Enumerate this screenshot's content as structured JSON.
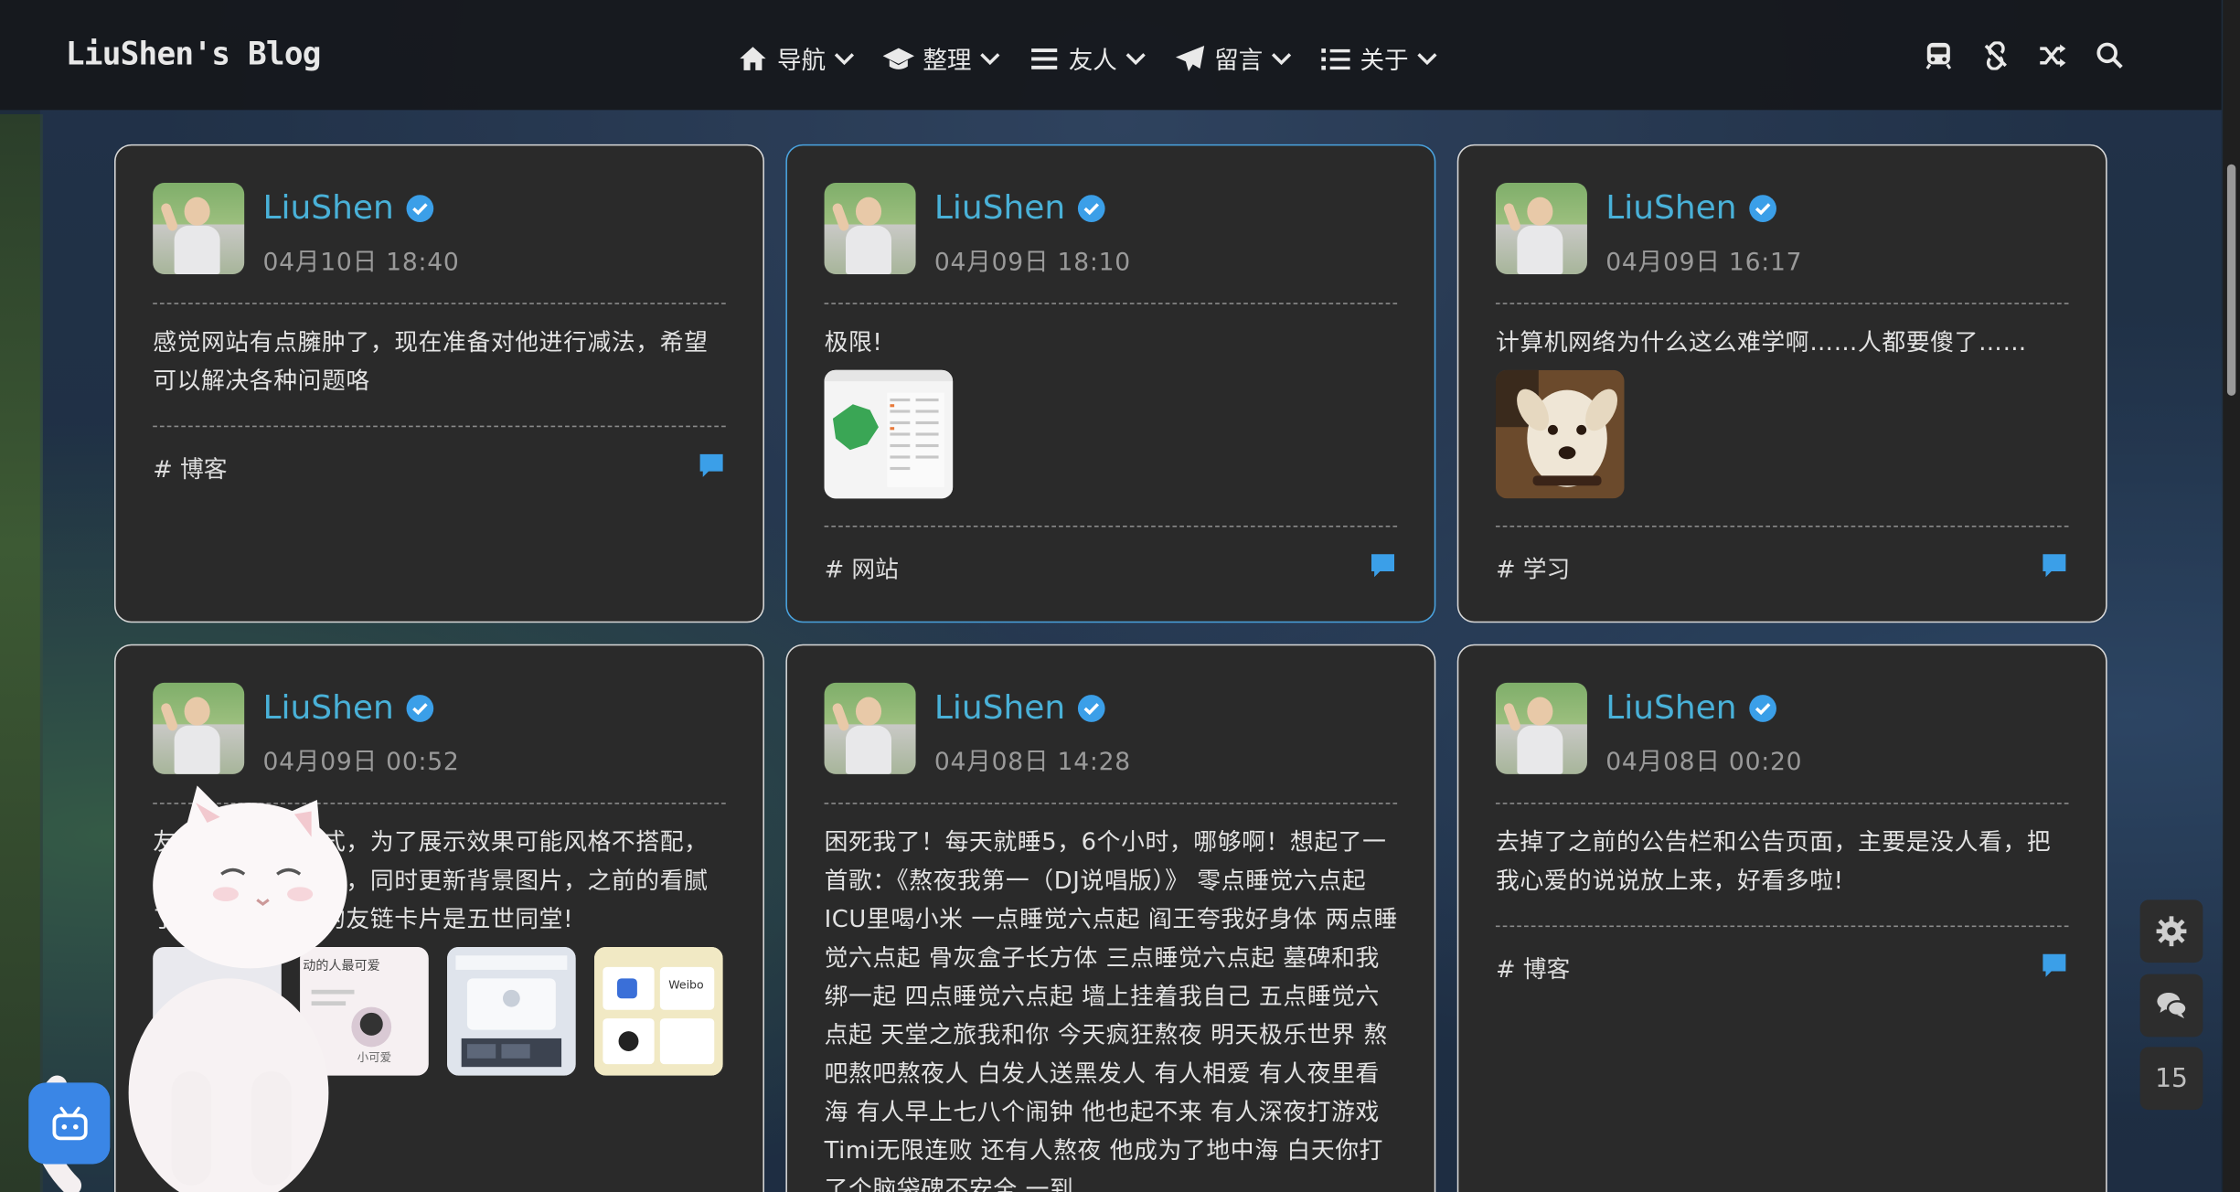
{
  "brand": "LiuShen's Blog",
  "nav": {
    "items": [
      {
        "icon": "home-icon",
        "label": "导航"
      },
      {
        "icon": "graduation-cap-icon",
        "label": "整理"
      },
      {
        "icon": "bars-icon",
        "label": "友人"
      },
      {
        "icon": "paper-plane-icon",
        "label": "留言"
      },
      {
        "icon": "list-icon",
        "label": "关于"
      }
    ],
    "right_icons": [
      "subway-icon",
      "unlink-icon",
      "shuffle-icon",
      "search-icon"
    ]
  },
  "cards": [
    {
      "user": "LiuShen",
      "date": "04月10日 18:40",
      "text": "感觉网站有点臃肿了，现在准备对他进行减法，希望可以解决各种问题咯",
      "tag": "# 博客"
    },
    {
      "user": "LiuShen",
      "date": "04月09日 18:10",
      "text": "极限!",
      "tag": "# 网站"
    },
    {
      "user": "LiuShen",
      "date": "04月09日 16:17",
      "text": "计算机网络为什么这么难学啊……人都要傻了……",
      "tag": "# 学习"
    },
    {
      "user": "LiuShen",
      "date": "04月09日 00:52",
      "text": "友链卡片换了样式，为了展示效果可能风格不搭配，这是重新写出来的，同时更新背景图片，之前的看腻了，哈哈，现在的友链卡片是五世同堂!",
      "thumb_texts": [
        "动的人最可爱",
        "小可爱",
        "Weibo"
      ]
    },
    {
      "user": "LiuShen",
      "date": "04月08日 14:28",
      "text": "困死我了！每天就睡5，6个小时，哪够啊！想起了一首歌：《熬夜我第一（DJ说唱版）》 零点睡觉六点起 ICU里喝小米 一点睡觉六点起 阎王夸我好身体 两点睡觉六点起 骨灰盒子长方体 三点睡觉六点起 墓碑和我绑一起 四点睡觉六点起 墙上挂着我自己 五点睡觉六点起 天堂之旅我和你 今天疯狂熬夜 明天极乐世界 熬吧熬吧熬夜人 白发人送黑发人 有人相爱 有人夜里看海 有人早上七八个闹钟 他也起不来 有人深夜打游戏 Timi无限连败 还有人熬夜 他成为了地中海 白天你打了个脑袋碑不安全 一到"
    },
    {
      "user": "LiuShen",
      "date": "04月08日 00:20",
      "text": "去掉了之前的公告栏和公告页面，主要是没人看，把我心爱的说说放上来，好看多啦!",
      "tag": "# 博客"
    }
  ],
  "side": {
    "count": "15"
  },
  "colors": {
    "accent": "#49b1d8",
    "verified": "#3b9fe8",
    "bot": "#3a86e6"
  }
}
